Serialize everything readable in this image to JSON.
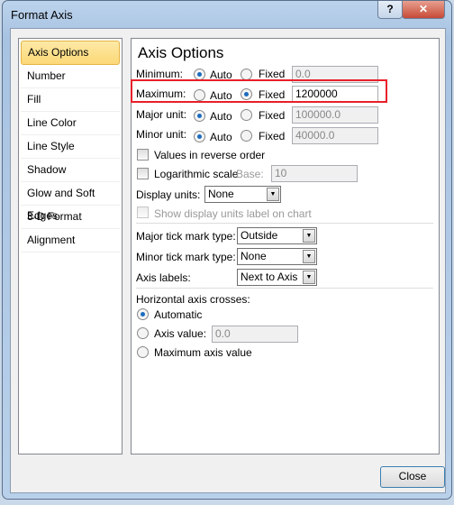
{
  "window": {
    "title": "Format Axis",
    "help": "?",
    "close": "✕"
  },
  "nav": [
    "Axis Options",
    "Number",
    "Fill",
    "Line Color",
    "Line Style",
    "Shadow",
    "Glow and Soft Edges",
    "3-D Format",
    "Alignment"
  ],
  "panel": {
    "heading": "Axis Options",
    "rows": [
      {
        "label": "Minimum:",
        "auto": "Auto",
        "fixed": "Fixed",
        "value": "0.0"
      },
      {
        "label": "Maximum:",
        "auto": "Auto",
        "fixed": "Fixed",
        "value": "1200000"
      },
      {
        "label": "Major unit:",
        "auto": "Auto",
        "fixed": "Fixed",
        "value": "100000.0"
      },
      {
        "label": "Minor unit:",
        "auto": "Auto",
        "fixed": "Fixed",
        "value": "40000.0"
      }
    ],
    "reverse": "Values in reverse order",
    "log": "Logarithmic scale",
    "base_label": "Base:",
    "base": "10",
    "display_units_label": "Display units:",
    "display_units": "None",
    "show_units": "Show display units label on chart",
    "major_tick_label": "Major tick mark type:",
    "major_tick": "Outside",
    "minor_tick_label": "Minor tick mark type:",
    "minor_tick": "None",
    "axis_labels_label": "Axis labels:",
    "axis_labels": "Next to Axis",
    "crosses_label": "Horizontal axis crosses:",
    "automatic": "Automatic",
    "axis_value": "Axis value:",
    "axis_value_input": "0.0",
    "max_axis_value": "Maximum axis value"
  },
  "close_button": "Close",
  "highlight_color": "#e8202a"
}
